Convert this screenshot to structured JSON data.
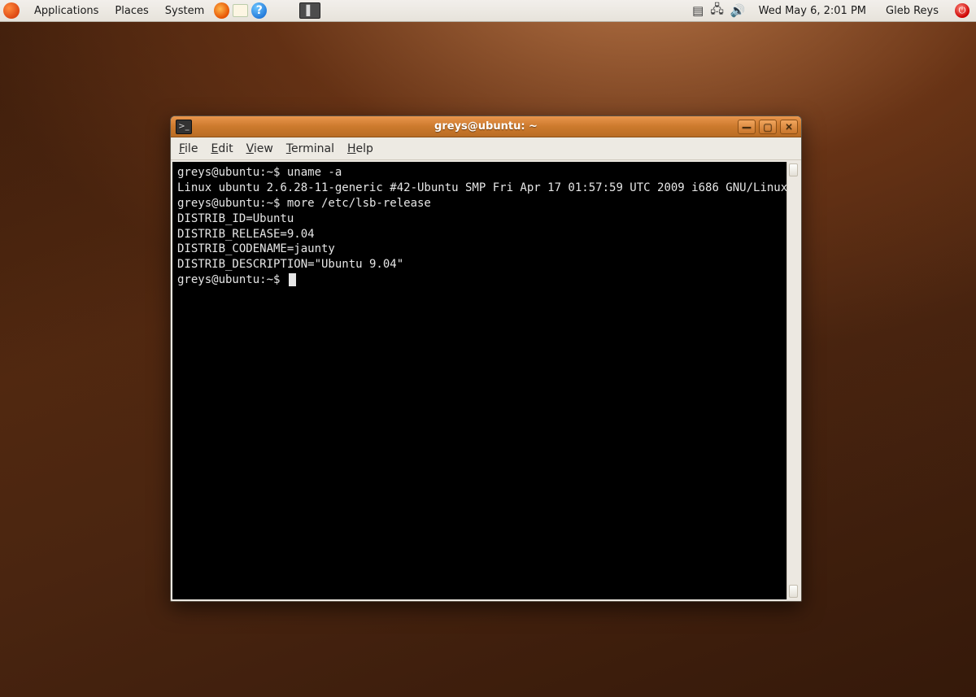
{
  "panel": {
    "menus": {
      "applications": "Applications",
      "places": "Places",
      "system": "System"
    },
    "clock": "Wed May  6,  2:01 PM",
    "username": "Gleb Reys"
  },
  "window": {
    "title": "greys@ubuntu: ~",
    "menus": {
      "file": "File",
      "edit": "Edit",
      "view": "View",
      "terminal": "Terminal",
      "help": "Help"
    }
  },
  "terminal": {
    "prompt": "greys@ubuntu:~$",
    "lines": [
      {
        "prompt": true,
        "text": "uname -a"
      },
      {
        "prompt": false,
        "text": "Linux ubuntu 2.6.28-11-generic #42-Ubuntu SMP Fri Apr 17 01:57:59 UTC 2009 i686 GNU/Linux"
      },
      {
        "prompt": true,
        "text": "more /etc/lsb-release"
      },
      {
        "prompt": false,
        "text": "DISTRIB_ID=Ubuntu"
      },
      {
        "prompt": false,
        "text": "DISTRIB_RELEASE=9.04"
      },
      {
        "prompt": false,
        "text": "DISTRIB_CODENAME=jaunty"
      },
      {
        "prompt": false,
        "text": "DISTRIB_DESCRIPTION=\"Ubuntu 9.04\""
      },
      {
        "prompt": true,
        "text": "",
        "cursor": true
      }
    ]
  },
  "colors": {
    "panel_bg": "#e9e5dd",
    "titlebar_orange": "#cc7a2d",
    "desktop_brown": "#4a2510",
    "terminal_bg": "#000000",
    "terminal_fg": "#e6e6e6"
  }
}
